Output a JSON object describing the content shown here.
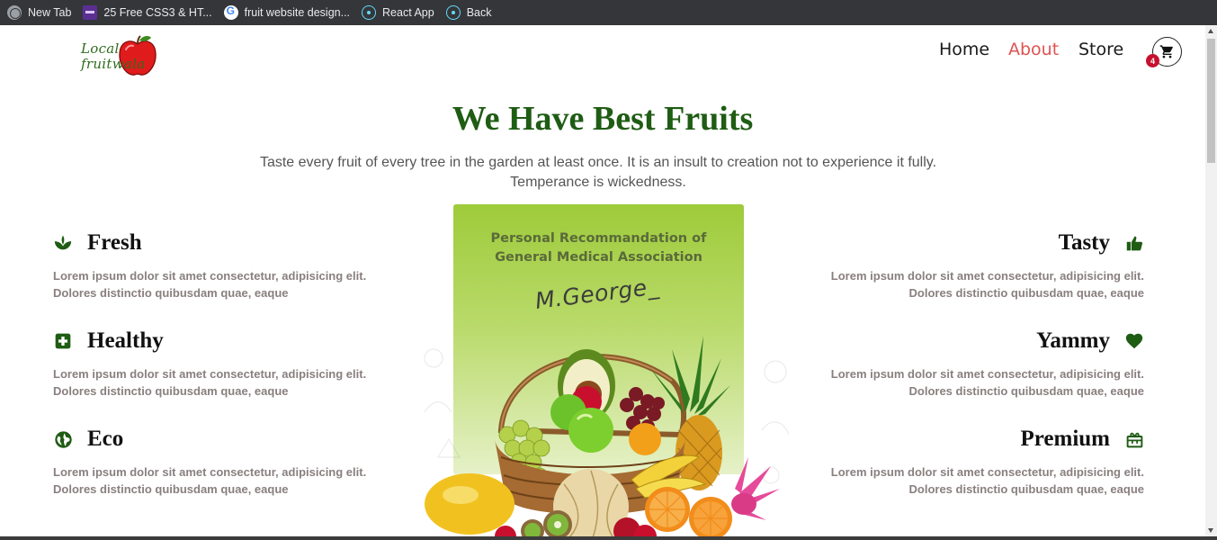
{
  "bookmarks": [
    {
      "label": "New Tab",
      "icon": "globe-icon"
    },
    {
      "label": "25 Free CSS3 & HT...",
      "icon": "colorlib-icon"
    },
    {
      "label": "fruit website design...",
      "icon": "google-icon"
    },
    {
      "label": "React App",
      "icon": "react-icon"
    },
    {
      "label": "Back",
      "icon": "react-icon"
    }
  ],
  "header": {
    "logo_line1": "Local",
    "logo_line2": "fruitwala",
    "nav": [
      {
        "label": "Home",
        "active": false
      },
      {
        "label": "About",
        "active": true
      },
      {
        "label": "Store",
        "active": false
      }
    ],
    "cart_count": "4"
  },
  "hero": {
    "title": "We Have Best Fruits",
    "subtitle_line1": "Taste every fruit of every tree in the garden at least once. It is an insult to creation not to experience it fully.",
    "subtitle_line2": "Temperance is wickedness."
  },
  "features_left": [
    {
      "title": "Fresh",
      "icon": "sprout-icon",
      "text": "Lorem ipsum dolor sit amet consectetur, adipisicing elit. Dolores distinctio quibusdam quae, eaque"
    },
    {
      "title": "Healthy",
      "icon": "medical-plus-icon",
      "text": "Lorem ipsum dolor sit amet consectetur, adipisicing elit. Dolores distinctio quibusdam quae, eaque"
    },
    {
      "title": "Eco",
      "icon": "globe-icon",
      "text": "Lorem ipsum dolor sit amet consectetur, adipisicing elit. Dolores distinctio quibusdam quae, eaque"
    }
  ],
  "features_right": [
    {
      "title": "Tasty",
      "icon": "thumbs-up-icon",
      "text": "Lorem ipsum dolor sit amet consectetur, adipisicing elit. Dolores distinctio quibusdam quae, eaque"
    },
    {
      "title": "Yammy",
      "icon": "heart-icon",
      "text": "Lorem ipsum dolor sit amet consectetur, adipisicing elit. Dolores distinctio quibusdam quae, eaque"
    },
    {
      "title": "Premium",
      "icon": "gift-icon",
      "text": "Lorem ipsum dolor sit amet consectetur, adipisicing elit. Dolores distinctio quibusdam quae, eaque"
    }
  ],
  "card": {
    "line1": "Personal Recommandation of",
    "line2": "General Medical Association",
    "signature": "M.George_"
  },
  "colors": {
    "brand_green": "#1f5c14",
    "nav_active": "#e05252",
    "badge": "#c8102e",
    "card_green": "#9ecb3a"
  }
}
